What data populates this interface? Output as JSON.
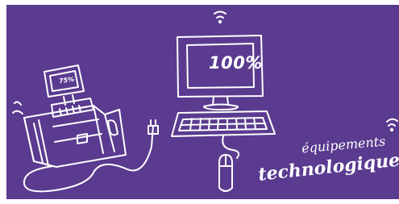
{
  "illustration": {
    "background_color": "#5a3b8f",
    "line_color": "#ffffff",
    "monitor_display_text": "100%",
    "terminal_display_text": "75%",
    "caption_line_1": "équipements",
    "caption_line_2": "technologiques",
    "icons": [
      "wifi-icon",
      "desktop-computer-icon",
      "keyboard-icon",
      "mouse-icon",
      "payment-terminal-icon",
      "power-plug-icon"
    ]
  }
}
